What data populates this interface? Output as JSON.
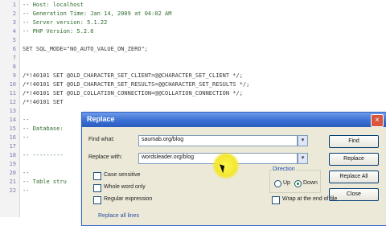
{
  "editor": {
    "lines": [
      {
        "no": "1",
        "text": "-- Host: localhost"
      },
      {
        "no": "2",
        "text": "-- Generation Time: Jan 14, 2009 at 04:02 AM"
      },
      {
        "no": "3",
        "text": "-- Server version: 5.1.22"
      },
      {
        "no": "4",
        "text": "-- PHP Version: 5.2.6"
      },
      {
        "no": "5",
        "text": ""
      },
      {
        "no": "6",
        "text": "SET SQL_MODE=\"NO_AUTO_VALUE_ON_ZERO\";"
      },
      {
        "no": "7",
        "text": ""
      },
      {
        "no": "8",
        "text": ""
      },
      {
        "no": "9",
        "text": "/*!40101 SET @OLD_CHARACTER_SET_CLIENT=@@CHARACTER_SET_CLIENT */;"
      },
      {
        "no": "10",
        "text": "/*!40101 SET @OLD_CHARACTER_SET_RESULTS=@@CHARACTER_SET_RESULTS */;"
      },
      {
        "no": "11",
        "text": "/*!40101 SET @OLD_COLLATION_CONNECTION=@@COLLATION_CONNECTION */;"
      },
      {
        "no": "12",
        "text": "/*!40101 SET"
      },
      {
        "no": "13",
        "text": ""
      },
      {
        "no": "14",
        "text": "--"
      },
      {
        "no": "15",
        "text": "-- Database:"
      },
      {
        "no": "16",
        "text": "--"
      },
      {
        "no": "17",
        "text": ""
      },
      {
        "no": "18",
        "text": "-- ---------"
      },
      {
        "no": "19",
        "text": ""
      },
      {
        "no": "20",
        "text": "--"
      },
      {
        "no": "21",
        "text": "-- Table stru"
      },
      {
        "no": "22",
        "text": "--"
      }
    ]
  },
  "dialog": {
    "title": "Replace",
    "close_glyph": "×",
    "find_label": "Find what:",
    "find_value": "saumab.org/blog",
    "replace_label": "Replace with:",
    "replace_value": "wordsleader.org/blog",
    "buttons": {
      "find": "Find",
      "replace": "Replace",
      "replace_all": "Replace All",
      "close": "Close"
    },
    "options": {
      "case_sensitive": "Case sensitive",
      "whole_word": "Whole word only",
      "regex": "Regular expression",
      "wrap": "Wrap at the end of file"
    },
    "direction": {
      "title": "Direction",
      "up": "Up",
      "down": "Down",
      "selected": "down"
    },
    "footer_link": "Replace all lines"
  },
  "icons": {
    "dropdown": "chevron-down-icon",
    "pointer": "mouse-pointer-icon"
  },
  "colors": {
    "titlebar": "#3a6fd3",
    "dialog_bg": "#ece9d8",
    "highlight": "#f3e630"
  }
}
